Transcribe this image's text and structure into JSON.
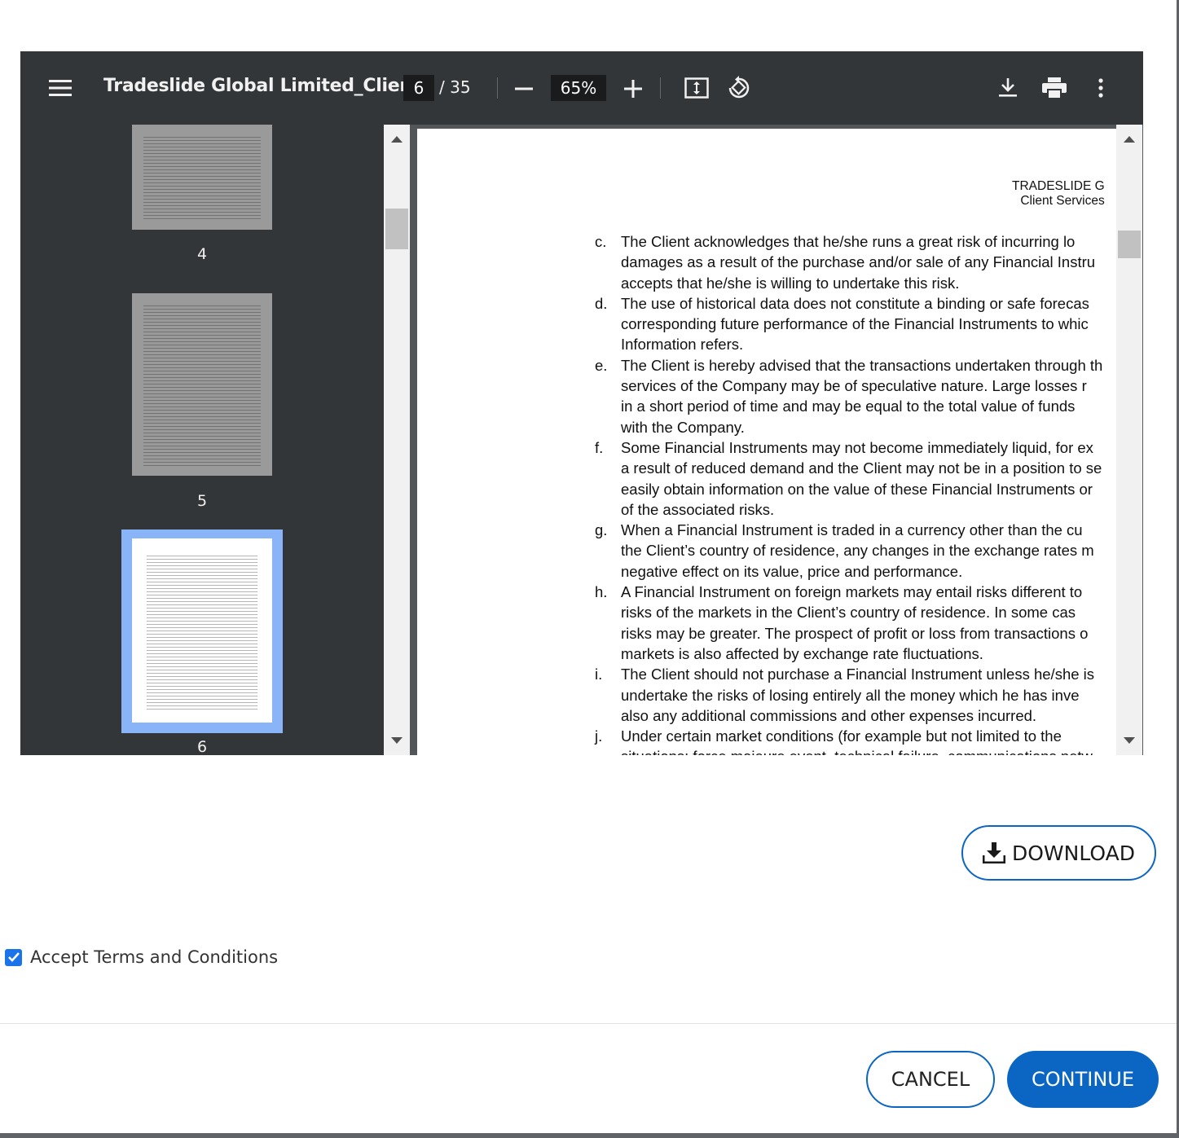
{
  "viewer": {
    "title": "Tradeslide Global Limited_Clien...",
    "current_page": "6",
    "total_pages": "/ 35",
    "zoom": "65%",
    "icons": [
      "menu-icon",
      "zoom-out-icon",
      "zoom-in-icon",
      "fit-page-icon",
      "rotate-icon",
      "download-icon",
      "print-icon",
      "more-icon"
    ]
  },
  "thumbnails": [
    {
      "number": "4"
    },
    {
      "number": "5"
    },
    {
      "number": "6",
      "selected": true
    }
  ],
  "document": {
    "header_line1": "TRADESLIDE G",
    "header_line2": "Client Services",
    "clauses": [
      {
        "letter": "c.",
        "lines": [
          "The Client acknowledges that he/she runs a great risk of incurring lo",
          "damages as a result of the purchase and/or sale of any Financial Instru",
          "accepts that he/she is willing to undertake this risk."
        ]
      },
      {
        "letter": "d.",
        "lines": [
          "The use of historical data does not constitute a binding or safe forecas",
          "corresponding future performance of the Financial Instruments to whic",
          "Information refers."
        ]
      },
      {
        "letter": "e.",
        "lines": [
          "The Client is hereby advised that the transactions undertaken through th",
          "services of the Company may be of speculative nature. Large losses r",
          "in a short period of time and may be equal to the total value of funds",
          "with the Company."
        ]
      },
      {
        "letter": "f.",
        "lines": [
          "Some Financial Instruments may not become immediately liquid, for ex",
          "a result of reduced demand and the Client may not be in a position to se",
          "easily obtain information on the value of these Financial Instruments or",
          "of the associated risks."
        ]
      },
      {
        "letter": "g.",
        "lines": [
          "When a Financial Instrument is traded in a currency other than the cu",
          "the Client’s country of residence, any changes in the exchange rates m",
          "negative effect on its value, price and performance."
        ]
      },
      {
        "letter": "h.",
        "lines": [
          "A Financial Instrument on foreign markets may entail risks different to",
          "risks of the markets in the Client’s country of residence. In some cas",
          "risks may be greater. The prospect of profit or loss from transactions o",
          "markets is also affected by exchange rate fluctuations."
        ]
      },
      {
        "letter": "i.",
        "lines": [
          "The Client should not purchase a Financial Instrument unless he/she is",
          "undertake the risks of losing entirely all the money which he has inve",
          "also any additional commissions and other expenses incurred."
        ]
      },
      {
        "letter": "j.",
        "lines": [
          "Under certain market conditions (for example but not limited to the",
          "situations: force majeure event, technical failure, communications netw"
        ]
      }
    ]
  },
  "actions": {
    "download_label": "DOWNLOAD",
    "accept_label": "Accept Terms and Conditions",
    "accept_checked": true,
    "cancel_label": "CANCEL",
    "continue_label": "CONTINUE"
  },
  "colors": {
    "accent": "#0a66c2",
    "toolbar": "#323639",
    "selected_thumb": "#8ab4f8"
  }
}
